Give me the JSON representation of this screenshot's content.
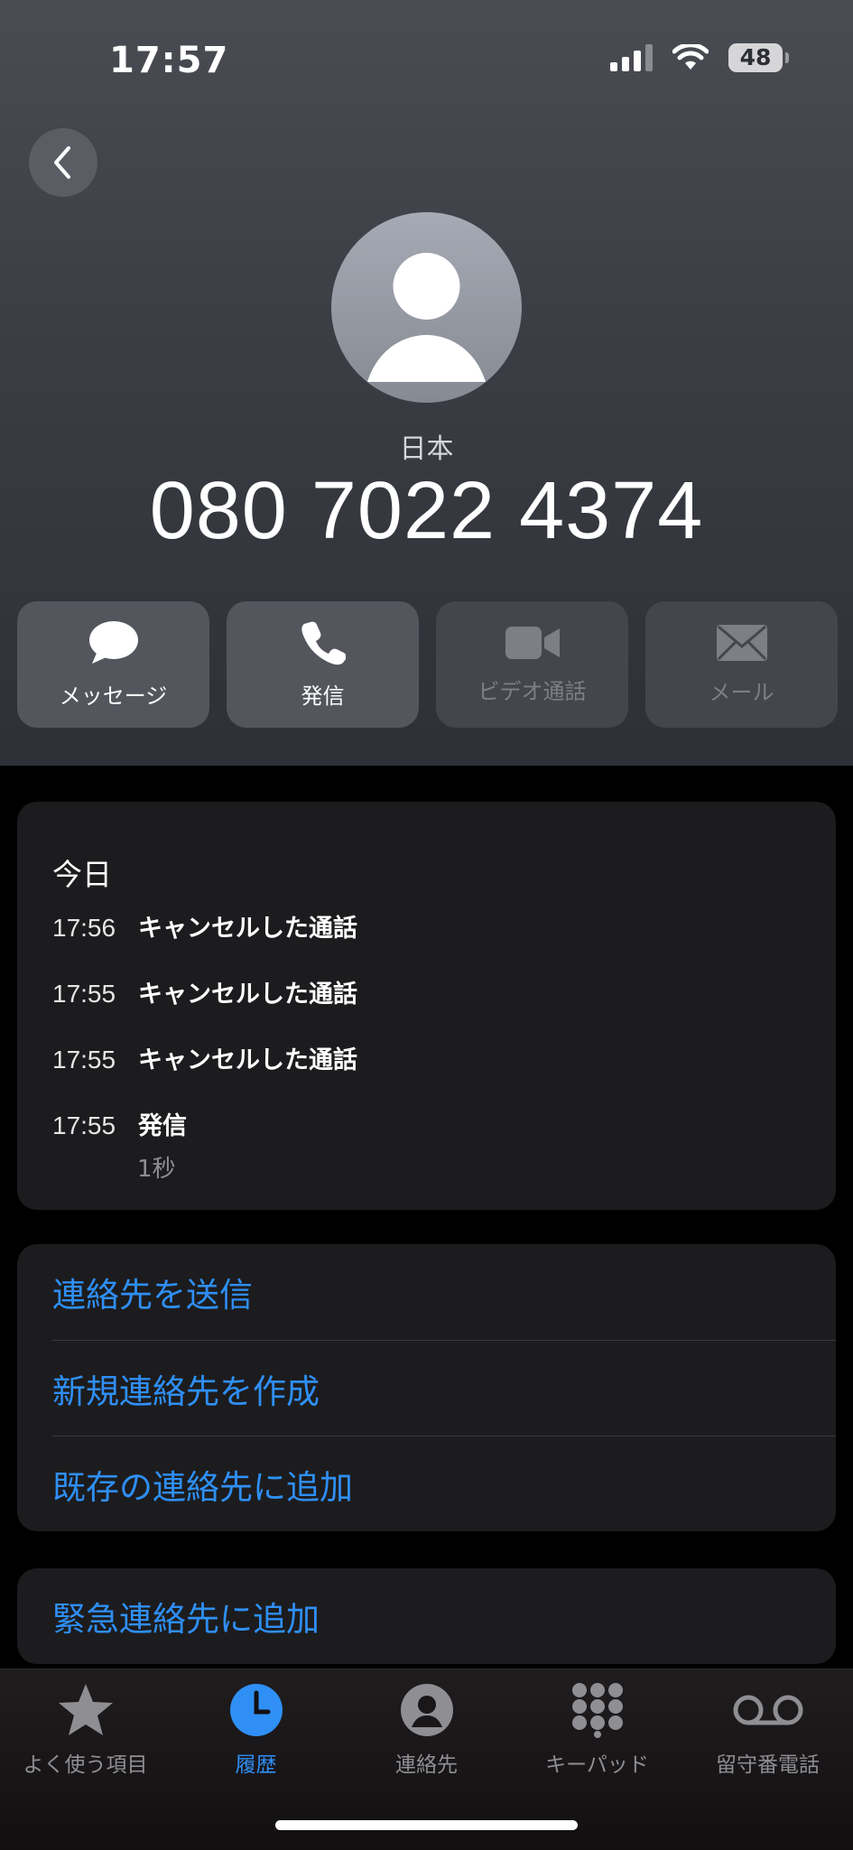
{
  "status_bar": {
    "time": "17:57",
    "battery": "48"
  },
  "contact": {
    "country": "日本",
    "number": "080 7022 4374"
  },
  "actions": [
    {
      "label": "メッセージ",
      "icon": "message-bubble-icon",
      "enabled": true
    },
    {
      "label": "発信",
      "icon": "phone-icon",
      "enabled": true
    },
    {
      "label": "ビデオ通話",
      "icon": "video-camera-icon",
      "enabled": false
    },
    {
      "label": "メール",
      "icon": "mail-envelope-icon",
      "enabled": false
    }
  ],
  "history": {
    "title": "今日",
    "calls": [
      {
        "time": "17:56",
        "type": "キャンセルした通話"
      },
      {
        "time": "17:55",
        "type": "キャンセルした通話"
      },
      {
        "time": "17:55",
        "type": "キャンセルした通話"
      },
      {
        "time": "17:55",
        "type": "発信",
        "duration": "1秒"
      }
    ]
  },
  "options": [
    {
      "label": "連絡先を送信"
    },
    {
      "label": "新規連絡先を作成"
    },
    {
      "label": "既存の連絡先に追加"
    }
  ],
  "emergency": {
    "label": "緊急連絡先に追加"
  },
  "tabbar": {
    "tabs": [
      {
        "label": "よく使う項目",
        "icon": "star-icon",
        "active": false
      },
      {
        "label": "履歴",
        "icon": "clock-icon",
        "active": true
      },
      {
        "label": "連絡先",
        "icon": "person-circle-icon",
        "active": false
      },
      {
        "label": "キーパッド",
        "icon": "keypad-icon",
        "active": false
      },
      {
        "label": "留守番電話",
        "icon": "voicemail-icon",
        "active": false
      }
    ]
  },
  "colors": {
    "accent": "#2f8ff5",
    "card": "#1c1c1e",
    "background": "#000000"
  }
}
